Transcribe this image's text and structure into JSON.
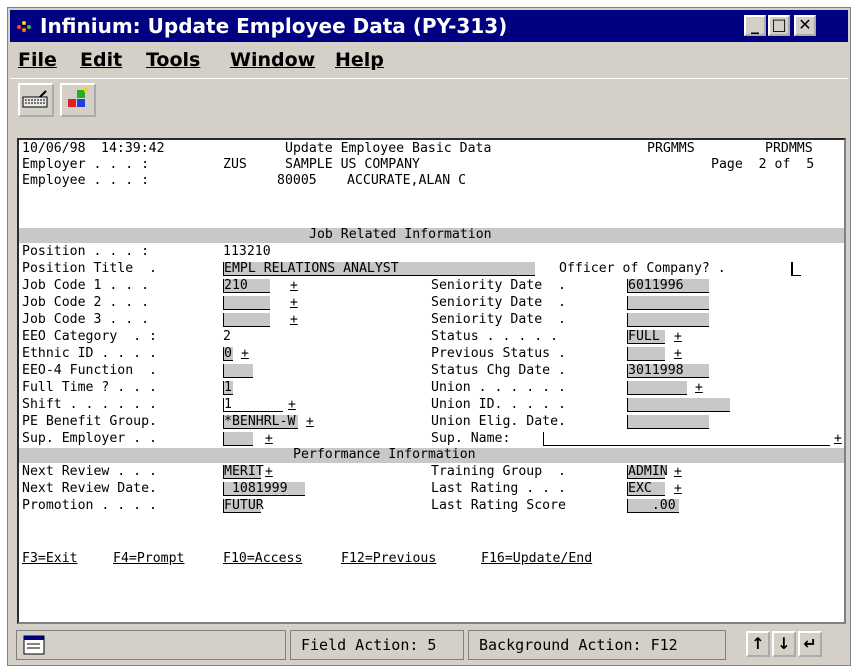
{
  "window": {
    "title": "Infinium: Update Employee Data (PY-313)",
    "min": "_",
    "max": "□",
    "close": "✕"
  },
  "menu": [
    "File",
    "Edit",
    "Tools",
    "Window",
    "Help"
  ],
  "header": {
    "date": "10/06/98",
    "time": "14:39:42",
    "screen_title": "Update Employee Basic Data",
    "prog1": "PRGMMS",
    "prog2": "PRDMMS",
    "employer_label": "Employer . . . :",
    "employer_code": "ZUS",
    "employer_name": "SAMPLE US COMPANY",
    "page": "Page  2 of  5",
    "employee_label": "Employee . . . :",
    "employee_id": "80005",
    "employee_name": "ACCURATE,ALAN C"
  },
  "sections": {
    "job": "Job Related Information",
    "perf": "Performance Information"
  },
  "job_left": [
    {
      "label": "Position . . . :",
      "value": "113210"
    },
    {
      "label": "Position Title  .",
      "value": "EMPL RELATIONS ANALYST"
    },
    {
      "label": "Job Code 1 . . .",
      "value": "210"
    },
    {
      "label": "Job Code 2 . . .",
      "value": ""
    },
    {
      "label": "Job Code 3 . . .",
      "value": ""
    },
    {
      "label": "EEO Category  . :",
      "value": "2"
    },
    {
      "label": "Ethnic ID . . . .",
      "value": "0"
    },
    {
      "label": "EEO-4 Function  .",
      "value": ""
    },
    {
      "label": "Full Time ? . . .",
      "value": "1"
    },
    {
      "label": "Shift . . . . . .",
      "value": "1"
    },
    {
      "label": "PE Benefit Group.",
      "value": "*BENHRL-W"
    },
    {
      "label": "Sup. Employer . .",
      "value": ""
    }
  ],
  "officer": {
    "label": "Officer of Company? .",
    "value": ""
  },
  "job_right": [
    {
      "label": "Seniority Date  .",
      "value": "6011996"
    },
    {
      "label": "Seniority Date  .",
      "value": ""
    },
    {
      "label": "Seniority Date  .",
      "value": ""
    },
    {
      "label": "Status . . . . .",
      "value": "FULL"
    },
    {
      "label": "Previous Status .",
      "value": ""
    },
    {
      "label": "Status Chg Date .",
      "value": "3011998"
    },
    {
      "label": "Union . . . . . .",
      "value": ""
    },
    {
      "label": "Union ID. . . . .",
      "value": ""
    },
    {
      "label": "Union Elig. Date.",
      "value": ""
    },
    {
      "label": "Sup. Name:",
      "value": ""
    }
  ],
  "perf_left": [
    {
      "label": "Next Review . . .",
      "value": "MERIT"
    },
    {
      "label": "Next Review Date.",
      "value": " 1081999"
    },
    {
      "label": "Promotion . . . .",
      "value": "FUTUR"
    }
  ],
  "perf_right": [
    {
      "label": "Training Group  .",
      "value": "ADMIN"
    },
    {
      "label": "Last Rating . . .",
      "value": "EXC"
    },
    {
      "label": "Last Rating Score",
      "value": "   .00"
    }
  ],
  "fkeys": [
    "F3=Exit",
    "F4=Prompt",
    "F10=Access",
    "F12=Previous",
    "F16=Update/End"
  ],
  "status": {
    "field_action": "Field Action: 5",
    "background_action": "Background Action: F12"
  },
  "prompt_marker": "+",
  "colors": {
    "title_bg": "#000080",
    "window_bg": "#d4d0c8",
    "field_bg": "#c8c8c8"
  }
}
